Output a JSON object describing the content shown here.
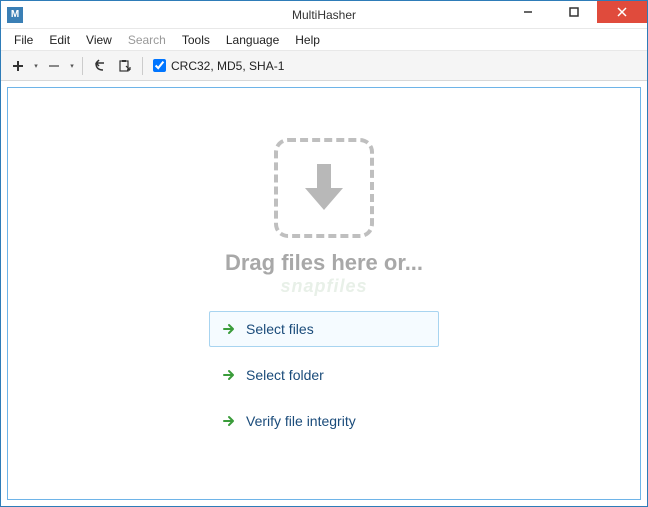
{
  "window": {
    "title": "MultiHasher",
    "icon_letter": "M"
  },
  "menu": {
    "file": "File",
    "edit": "Edit",
    "view": "View",
    "search": "Search",
    "tools": "Tools",
    "language": "Language",
    "help": "Help"
  },
  "toolbar": {
    "hash_algos": "CRC32, MD5, SHA-1",
    "hash_checked": true
  },
  "main": {
    "drag_text": "Drag files here or...",
    "watermark": "snapfiles",
    "actions": {
      "select_files": "Select files",
      "select_folder": "Select folder",
      "verify": "Verify file integrity"
    }
  }
}
